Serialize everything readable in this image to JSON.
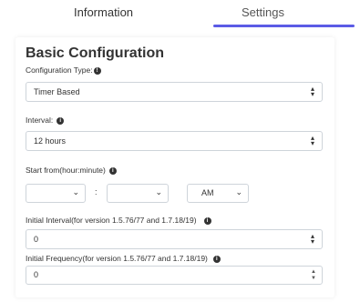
{
  "tabs": {
    "information": "Information",
    "settings": "Settings"
  },
  "section_title": "Basic Configuration",
  "configuration_type": {
    "label": "Configuration Type:",
    "value": "Timer Based"
  },
  "interval": {
    "label": "Interval:",
    "value": "12 hours"
  },
  "start_from": {
    "label": "Start from(hour:minute)",
    "hour": "",
    "separator": ":",
    "minute": "",
    "ampm": "AM"
  },
  "initial_interval": {
    "label": "Initial Interval(for version 1.5.76/77 and 1.7.18/19)",
    "value": "0"
  },
  "initial_frequency": {
    "label": "Initial Frequency(for version 1.5.76/77 and 1.7.18/19)",
    "value": "0"
  },
  "accent_color": "#5b5be6"
}
